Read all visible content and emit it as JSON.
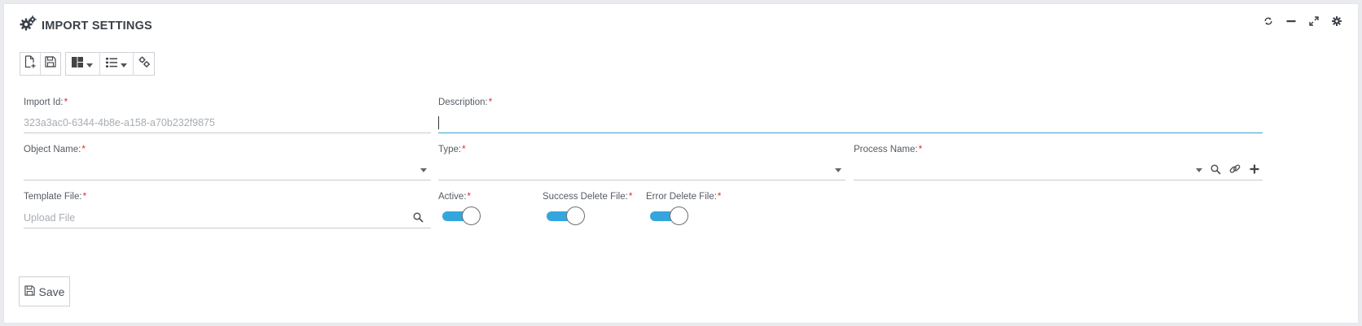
{
  "header": {
    "title": "IMPORT SETTINGS",
    "icon": "cogs-icon",
    "tools": [
      "refresh-icon",
      "minimize-icon",
      "expand-icon",
      "gear-icon"
    ]
  },
  "toolbar": {
    "icons": [
      "new-file-icon",
      "save-icon",
      "layout-icon",
      "list-icon",
      "settings-cogs-icon"
    ]
  },
  "form": {
    "import_id": {
      "label": "Import Id:",
      "required": "*",
      "value": "323a3ac0-6344-4b8e-a158-a70b232f9875"
    },
    "description": {
      "label": "Description:",
      "required": "*",
      "value": ""
    },
    "object_name": {
      "label": "Object Name:",
      "required": "*",
      "value": ""
    },
    "type": {
      "label": "Type:",
      "required": "*",
      "value": ""
    },
    "process_name": {
      "label": "Process Name:",
      "required": "*",
      "value": ""
    },
    "template_file": {
      "label": "Template File:",
      "required": "*",
      "placeholder": "Upload File"
    },
    "active": {
      "label": "Active:",
      "required": "*",
      "on": true
    },
    "success_delete_file": {
      "label": "Success Delete File:",
      "required": "*",
      "on": true
    },
    "error_delete_file": {
      "label": "Error Delete File:",
      "required": "*",
      "on": true
    }
  },
  "footer": {
    "save_label": "Save"
  },
  "colors": {
    "accent": "#35a6dd",
    "required": "#e0282e"
  }
}
